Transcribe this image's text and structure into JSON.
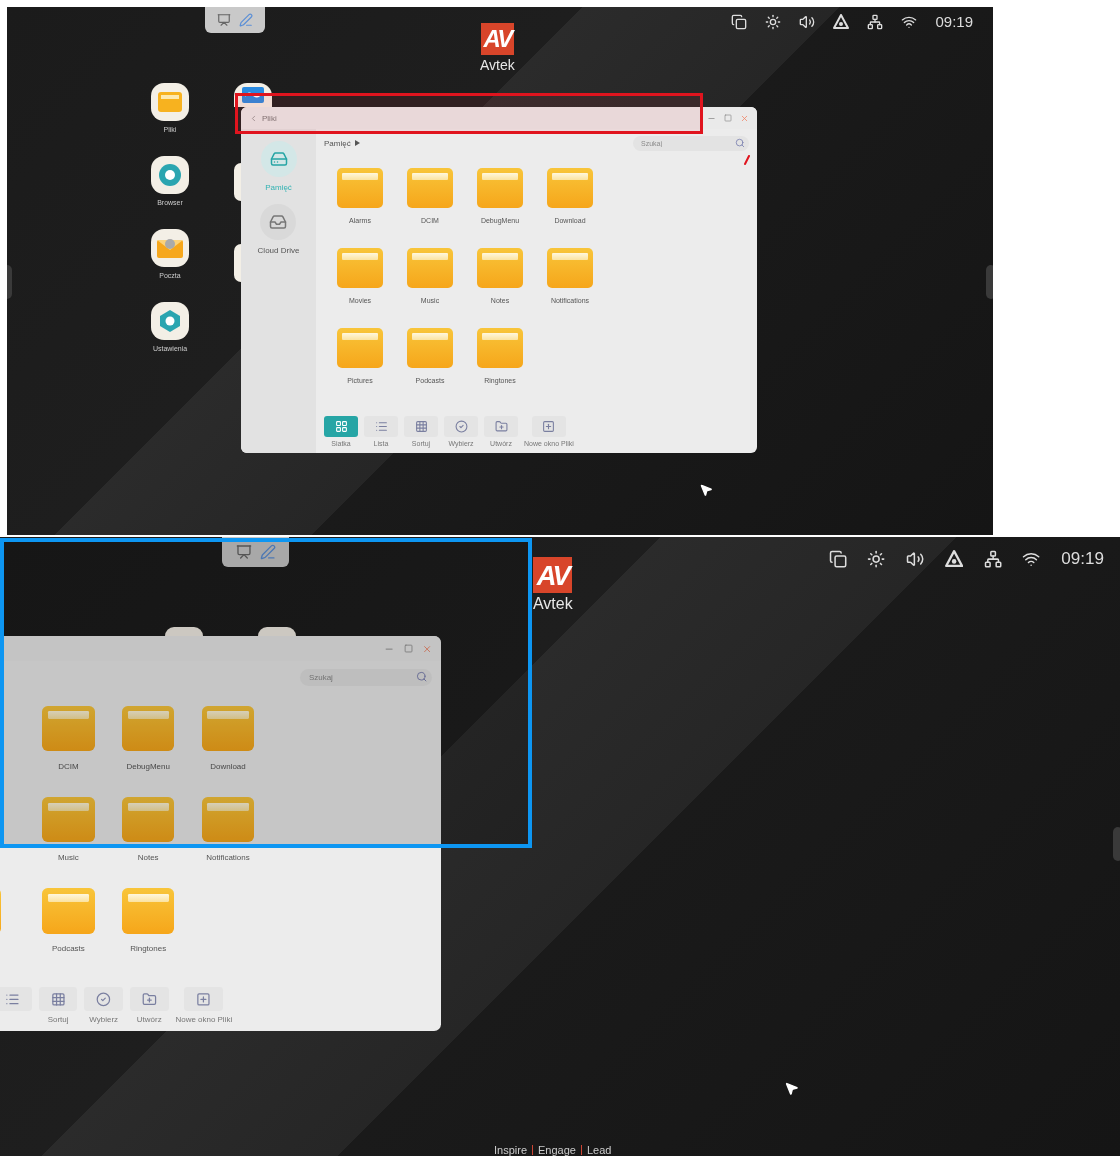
{
  "top_screen": {
    "toolbar": [
      {
        "kind": "whiteboard"
      },
      {
        "kind": "pen"
      }
    ],
    "logo": {
      "mark": "AV",
      "name": "Avtek"
    },
    "status": {
      "icons": [
        {
          "kind": "screens"
        },
        {
          "kind": "brightness"
        },
        {
          "kind": "volume"
        },
        {
          "kind": "cast"
        },
        {
          "kind": "network"
        },
        {
          "kind": "wifi"
        }
      ],
      "time": "09:19"
    },
    "desktop_apps": [
      {
        "label": "Pliki",
        "kind": "files"
      },
      {
        "label": "Browser",
        "kind": "browser"
      },
      {
        "label": "Poczta",
        "kind": "mail"
      },
      {
        "label": "Ustawienia",
        "kind": "settings"
      }
    ],
    "window": {
      "title": "Pliki",
      "sidebar": [
        {
          "label": "Pamięć",
          "kind": "storage",
          "selected": true
        },
        {
          "label": "Cloud Drive",
          "kind": "cloud",
          "selected": false
        }
      ],
      "breadcrumb": "Pamięć",
      "search": {
        "placeholder": "Szukaj"
      },
      "folders": [
        {
          "label": "Alarms"
        },
        {
          "label": "DCIM"
        },
        {
          "label": "DebugMenu"
        },
        {
          "label": "Download"
        },
        {
          "label": "Movies"
        },
        {
          "label": "Music"
        },
        {
          "label": "Notes"
        },
        {
          "label": "Notifications"
        },
        {
          "label": "Pictures"
        },
        {
          "label": "Podcasts"
        },
        {
          "label": "Ringtones"
        }
      ],
      "toolbar": [
        {
          "label": "Siatka",
          "kind": "grid",
          "selected": true
        },
        {
          "label": "Lista",
          "kind": "list",
          "selected": false
        },
        {
          "label": "Sortuj",
          "kind": "sort",
          "selected": false
        },
        {
          "label": "Wybierz",
          "kind": "select",
          "selected": false
        },
        {
          "label": "Utwórz",
          "kind": "create",
          "selected": false
        },
        {
          "label": "Nowe okno Pliki",
          "kind": "new-window",
          "selected": false
        }
      ]
    }
  },
  "bottom_screen": {
    "toolbar": [
      {
        "kind": "whiteboard"
      },
      {
        "kind": "pen"
      }
    ],
    "logo": {
      "mark": "AV",
      "name": "Avtek"
    },
    "status": {
      "icons": [
        {
          "kind": "screens"
        },
        {
          "kind": "brightness"
        },
        {
          "kind": "volume"
        },
        {
          "kind": "cast"
        },
        {
          "kind": "network"
        },
        {
          "kind": "wifi"
        }
      ],
      "time": "09:19"
    },
    "window": {
      "search": {
        "placeholder": "Szukaj"
      },
      "folders": [
        {
          "label": "DCIM"
        },
        {
          "label": "DebugMenu"
        },
        {
          "label": "Download"
        },
        {
          "label": "Music"
        },
        {
          "label": "Notes"
        },
        {
          "label": "Notifications"
        },
        {
          "label": "Podcasts"
        },
        {
          "label": "Ringtones"
        }
      ],
      "toolbar": [
        {
          "kind": "list",
          "partial": true
        },
        {
          "label": "Sortuj",
          "kind": "sort",
          "partial": false
        },
        {
          "label": "Wybierz",
          "kind": "select",
          "partial": false
        },
        {
          "label": "Utwórz",
          "kind": "create",
          "partial": false
        },
        {
          "label": "Nowe okno Pliki",
          "kind": "new-window",
          "partial": false
        }
      ]
    },
    "tagline": [
      "Inspire",
      "Engage",
      "Lead"
    ]
  }
}
